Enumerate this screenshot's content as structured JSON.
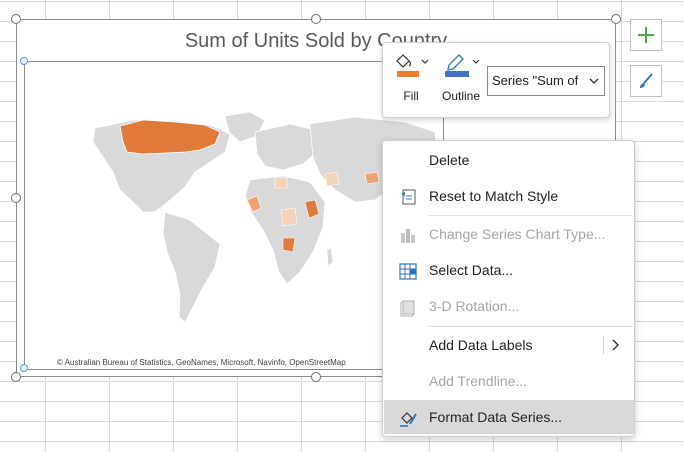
{
  "chart": {
    "title": "Sum of Units Sold by Country",
    "copyright": "© Australian Bureau of Statistics, GeoNames, Microsoft, Navinfo, OpenStreetMap"
  },
  "side_buttons": {
    "add": "plus-icon",
    "style": "brush-icon"
  },
  "mini_toolbar": {
    "fill_label": "Fill",
    "outline_label": "Outline",
    "series_value": "Series \"Sum of",
    "fill_color": "#ed7d31",
    "outline_color": "#4472c4"
  },
  "context_menu": {
    "items": [
      {
        "label": "Delete",
        "enabled": true
      },
      {
        "label": "Reset to Match Style",
        "enabled": true
      },
      {
        "label": "Change Series Chart Type...",
        "enabled": false
      },
      {
        "label": "Select Data...",
        "enabled": true
      },
      {
        "label": "3-D Rotation...",
        "enabled": false
      },
      {
        "label": "Add Data Labels",
        "enabled": true,
        "submenu": true
      },
      {
        "label": "Add Trendline...",
        "enabled": false
      },
      {
        "label": "Format Data Series...",
        "enabled": true,
        "highlighted": true
      }
    ]
  },
  "colors": {
    "land": "#d9d9d9",
    "highlight_dark": "#e07b39",
    "highlight_mid": "#eca274",
    "highlight_light": "#f6d2b8"
  }
}
